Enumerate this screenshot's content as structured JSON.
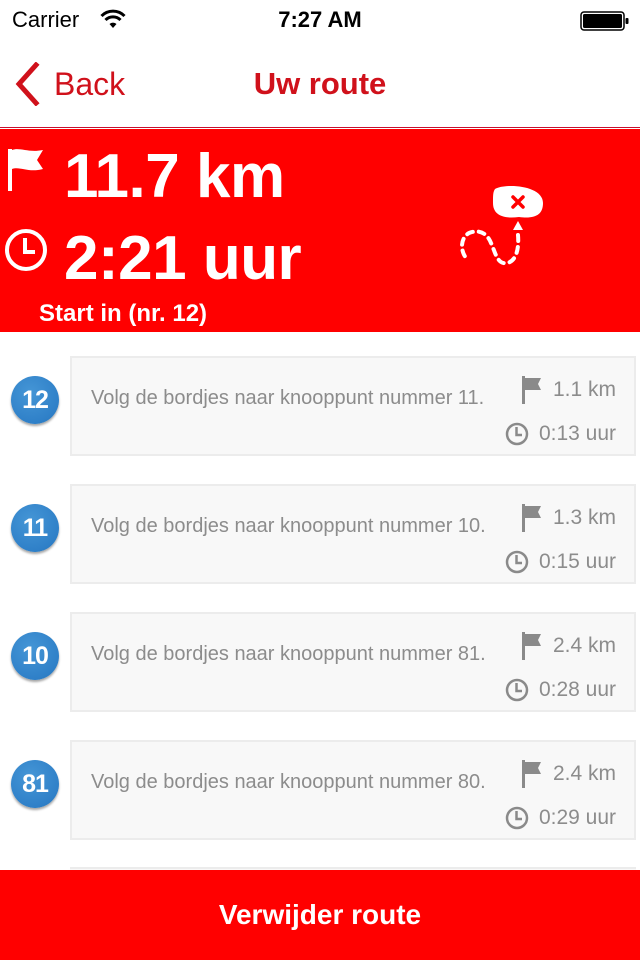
{
  "status_bar": {
    "carrier": "Carrier",
    "time": "7:27 AM",
    "icons": [
      "wifi-icon",
      "battery-icon"
    ]
  },
  "nav": {
    "back_label": "Back",
    "title": "Uw route",
    "back_icon": "chevron-left-icon"
  },
  "summary": {
    "distance": "11.7 km",
    "duration": "2:21 uur",
    "start_text": "Start in  (nr. 12)",
    "distance_icon": "flag-icon",
    "duration_icon": "clock-icon",
    "route_icon": "route-with-delete-marker-icon"
  },
  "legs": [
    {
      "node": "12",
      "instruction": "Volg de bordjes naar knooppunt nummer 11.",
      "distance": "1.1 km",
      "duration": "0:13 uur"
    },
    {
      "node": "11",
      "instruction": "Volg de bordjes naar knooppunt nummer 10.",
      "distance": "1.3 km",
      "duration": "0:15 uur"
    },
    {
      "node": "10",
      "instruction": "Volg de bordjes naar knooppunt nummer 81.",
      "distance": "2.4 km",
      "duration": "0:28 uur"
    },
    {
      "node": "81",
      "instruction": "Volg de bordjes naar knooppunt nummer 80.",
      "distance": "2.4 km",
      "duration": "0:29 uur"
    }
  ],
  "footer": {
    "delete_label": "Verwijder route"
  },
  "colors": {
    "brand_red": "#ff0000",
    "nav_red": "#d0111b",
    "badge_blue": "#2f80c8",
    "muted_text": "#8c8c8c"
  }
}
